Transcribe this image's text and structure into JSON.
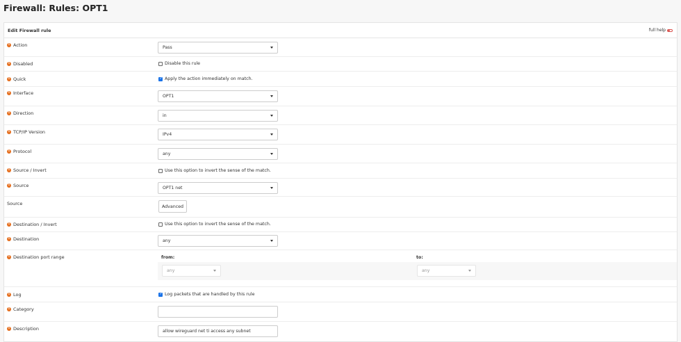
{
  "page_title": "Firewall: Rules: OPT1",
  "panel": {
    "title": "Edit Firewall rule",
    "full_help": "full help"
  },
  "fields": {
    "action": {
      "label": "Action",
      "value": "Pass"
    },
    "disabled": {
      "label": "Disabled",
      "text": "Disable this rule",
      "checked": false
    },
    "quick": {
      "label": "Quick",
      "text": "Apply the action immediately on match.",
      "checked": true
    },
    "interface": {
      "label": "Interface",
      "value": "OPT1"
    },
    "direction": {
      "label": "Direction",
      "value": "in"
    },
    "tcpip": {
      "label": "TCP/IP Version",
      "value": "IPv4"
    },
    "protocol": {
      "label": "Protocol",
      "value": "any"
    },
    "source_invert": {
      "label": "Source / Invert",
      "text": "Use this option to invert the sense of the match.",
      "checked": false
    },
    "source": {
      "label": "Source",
      "value": "OPT1 net"
    },
    "source_adv": {
      "label": "Source",
      "button": "Advanced"
    },
    "dest_invert": {
      "label": "Destination / Invert",
      "text": "Use this option to invert the sense of the match.",
      "checked": false
    },
    "destination": {
      "label": "Destination",
      "value": "any"
    },
    "dest_port": {
      "label": "Destination port range",
      "from_label": "from:",
      "to_label": "to:",
      "from_value": "any",
      "to_value": "any"
    },
    "log": {
      "label": "Log",
      "text": "Log packets that are handled by this rule",
      "checked": true
    },
    "category": {
      "label": "Category",
      "value": ""
    },
    "description": {
      "label": "Description",
      "value": "allow wireguard net ti access any subnet"
    }
  },
  "colors": {
    "info_icon": "#e56f1f",
    "checkbox_checked": "#1a73e8",
    "help_toggle": "#d9534f"
  }
}
